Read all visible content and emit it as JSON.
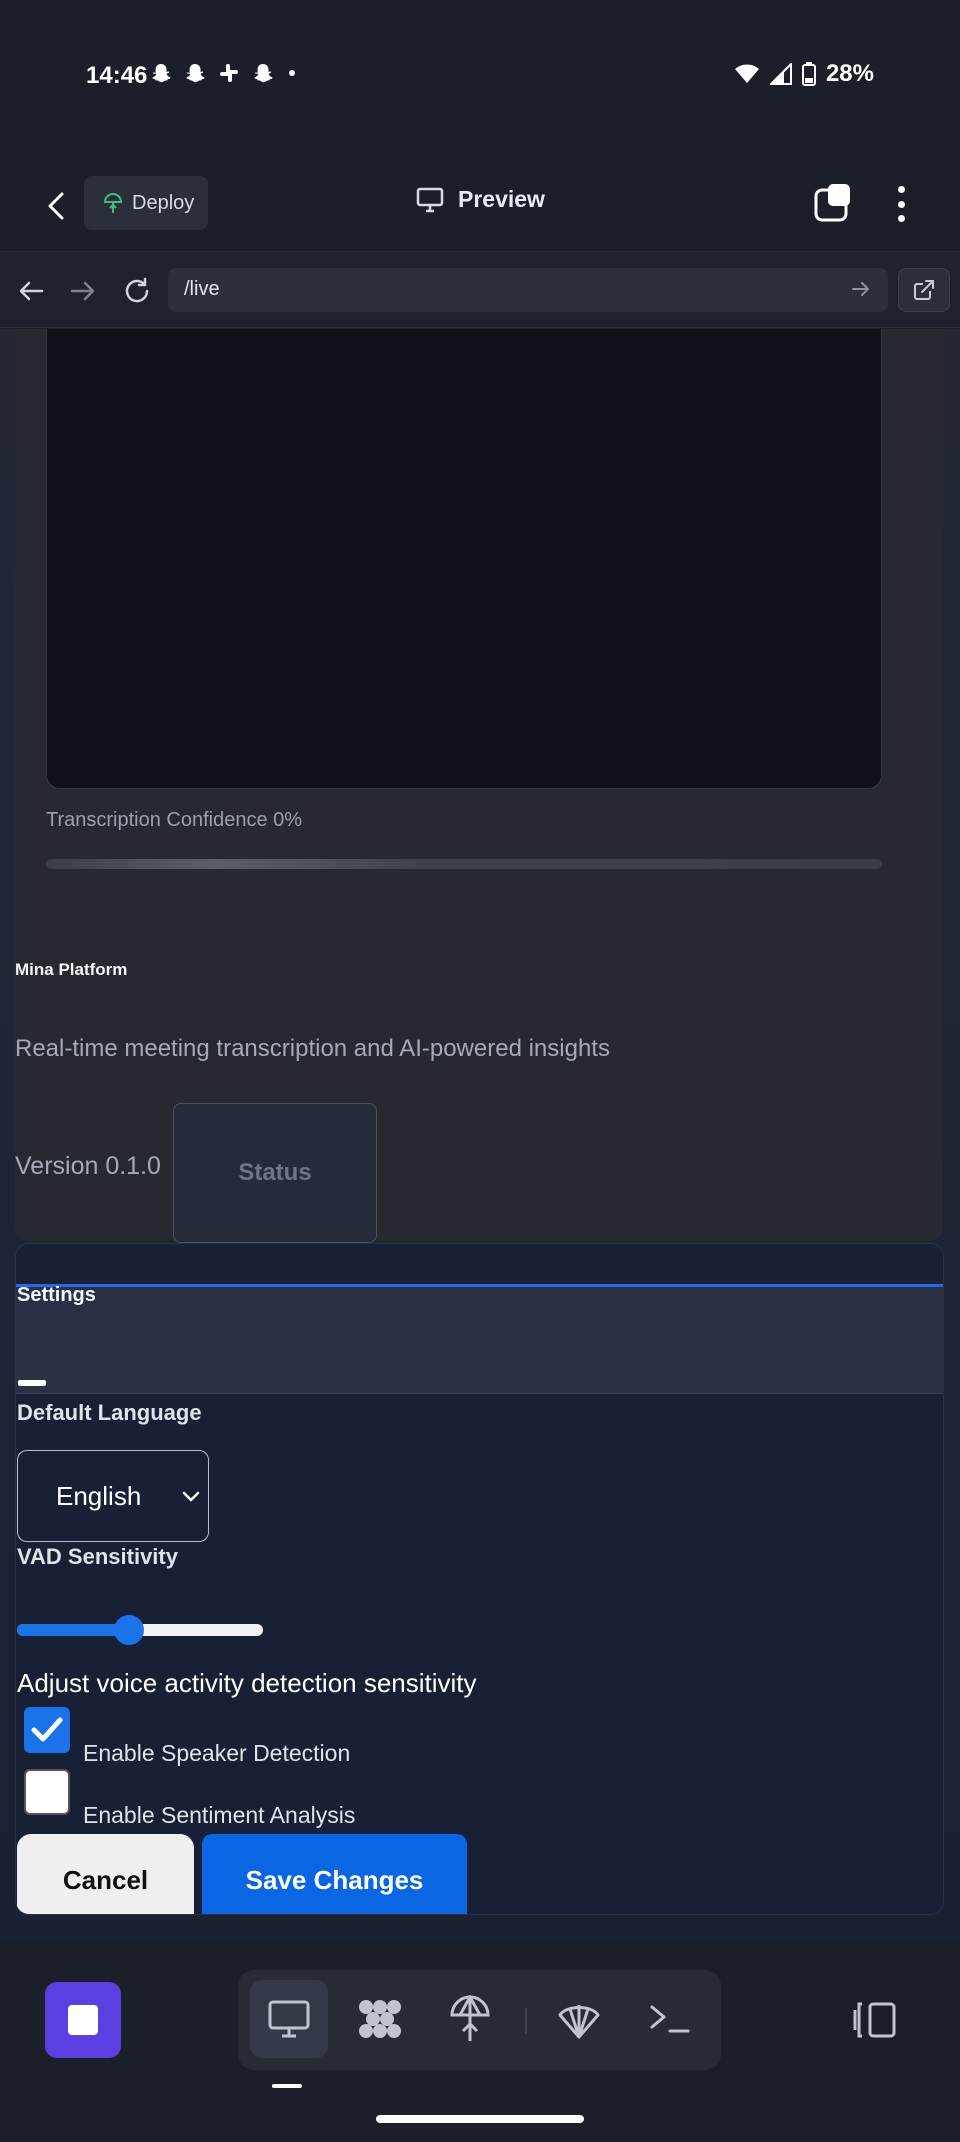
{
  "status_bar": {
    "time": "14:46",
    "notification_icons": [
      "snapchat-icon",
      "snapchat-icon",
      "slack-icon",
      "snapchat-icon",
      "dot-icon"
    ],
    "battery": "28%"
  },
  "app_bar": {
    "deploy_label": "Deploy",
    "preview_label": "Preview"
  },
  "browser": {
    "url": "/live"
  },
  "live_card": {
    "confidence_label": "Transcription Confidence 0%",
    "confidence_value": 0
  },
  "platform": {
    "brand": "Mina Platform",
    "tagline": "Real-time meeting transcription and AI-powered insights",
    "version": "Version 0.1.0",
    "status_button": "Status"
  },
  "settings": {
    "title": "Settings",
    "default_language_label": "Default Language",
    "language_value": "English",
    "vad_label": "VAD Sensitivity",
    "vad_value": 0.45,
    "vad_help": "Adjust voice activity detection sensitivity",
    "speaker_detection_label": "Enable Speaker Detection",
    "speaker_detection_checked": true,
    "sentiment_label": "Enable Sentiment Analysis",
    "sentiment_checked": false,
    "cancel_label": "Cancel",
    "save_label": "Save Changes"
  },
  "colors": {
    "accent": "#1a73e8",
    "stop_button": "#5b3fe0",
    "deploy_icon": "#3fbf7f"
  },
  "dock": {
    "items": [
      "monitor-icon",
      "extensions-icon",
      "deploy-icon",
      "shell-icon",
      "terminal-icon"
    ],
    "active": "monitor-icon"
  }
}
